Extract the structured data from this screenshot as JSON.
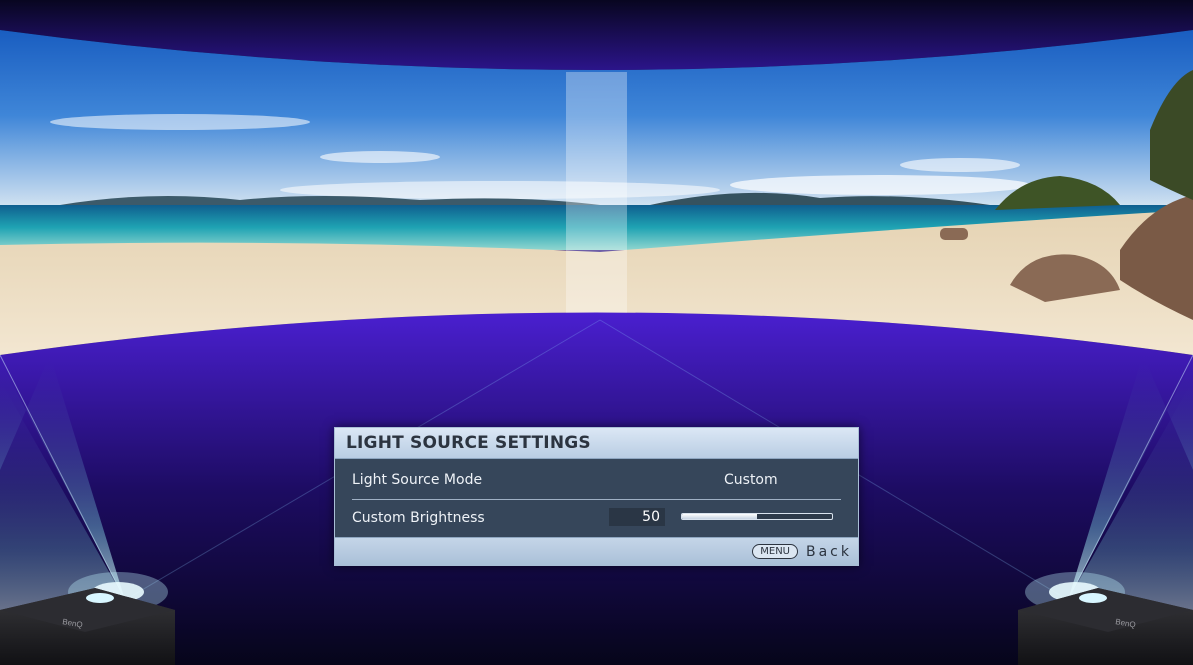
{
  "osd": {
    "title": "LIGHT SOURCE SETTINGS",
    "rows": [
      {
        "label": "Light Source Mode",
        "value": "Custom"
      },
      {
        "label": "Custom Brightness",
        "value": "50",
        "slider_fraction": 0.5
      }
    ],
    "footer": {
      "menu_key": "MENU",
      "back_label": "Back"
    }
  },
  "projectors": {
    "left_brand": "BenQ",
    "right_brand": "BenQ"
  },
  "colors": {
    "osd_header": "#c7d8ec",
    "osd_body": "#36465a",
    "backdrop_glow": "#3d1fb0"
  }
}
